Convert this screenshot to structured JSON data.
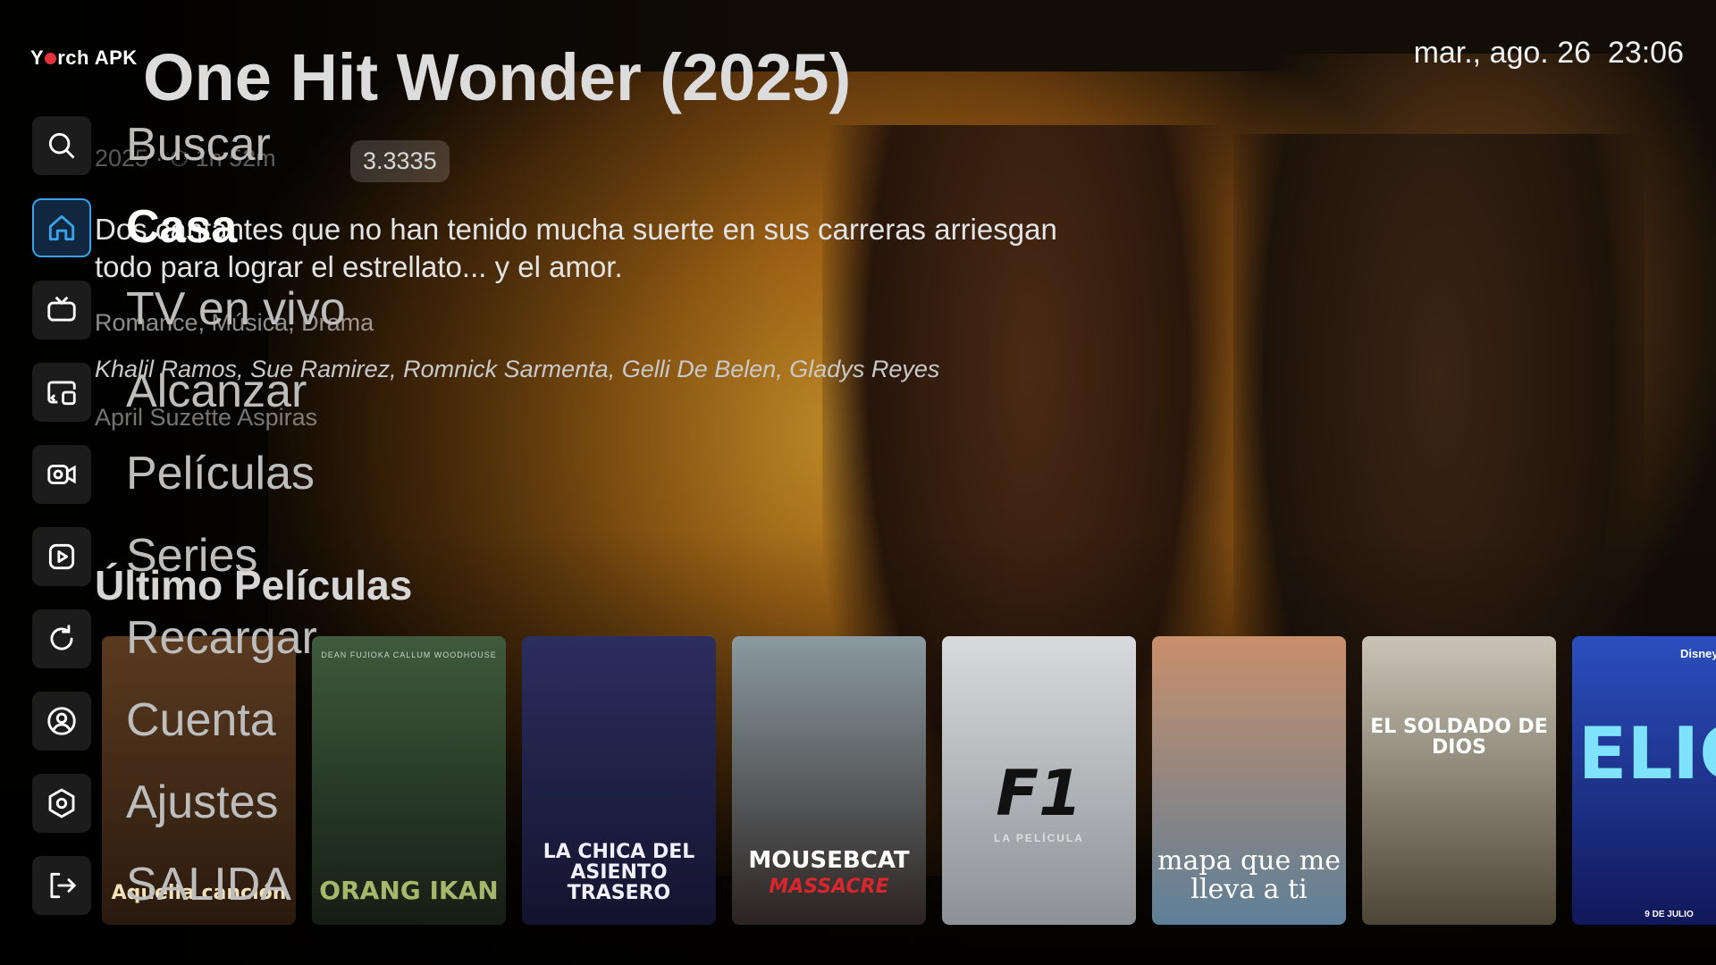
{
  "app": {
    "logo_left": "Y",
    "logo_right": "rch APK"
  },
  "datetime": "mar., ago. 26  23:06",
  "hero": {
    "title": "One Hit Wonder (2025)",
    "meta": "2025 · ⏱ 1h 52m",
    "rating": "3.3335",
    "description": "Dos cantantes que no han tenido mucha suerte en sus carreras arriesgan todo para lograr el estrellato... y el amor.",
    "genres": "Romance, Música, Drama",
    "cast": "Khalil Ramos, Sue Ramirez, Romnick Sarmenta, Gelli De Belen, Gladys Reyes",
    "director": "April Suzette Aspiras"
  },
  "row": {
    "title": "Último Películas",
    "posters": [
      {
        "title": "Aquella canción",
        "colors": [
          "#5a3a1f",
          "#2a1a0e"
        ],
        "text_color": "#f3e1b8"
      },
      {
        "title": "ORANG IKAN",
        "top_credit": "DEAN FUJIOKA   CALLUM WOODHOUSE",
        "colors": [
          "#3f5a3c",
          "#141e14"
        ],
        "text_color": "#a3b86a"
      },
      {
        "title": "LA CHICA DEL ASIENTO TRASERO",
        "colors": [
          "#2b2e5e",
          "#14132e"
        ],
        "text_color": "#f0f0ff"
      },
      {
        "title": "MOUSEBCAT",
        "subtitle_red": "MASSACRE",
        "colors": [
          "#8a9aa0",
          "#2b2321"
        ],
        "text_color": "#ffffff"
      },
      {
        "title": "F1",
        "subtitle": "LA PELÍCULA",
        "colors": [
          "#d9dadc",
          "#8d9196"
        ],
        "text_color": "#111111"
      },
      {
        "title": "mapa que me lleva a ti",
        "colors": [
          "#c98f6b",
          "#5e7f97"
        ],
        "text_color": "#ffffff"
      },
      {
        "title": "EL SOLDADO DE DIOS",
        "colors": [
          "#c9c4b7",
          "#4d4536"
        ],
        "text_color": "#ffffff"
      },
      {
        "title": "ELIO",
        "corner": "Disney PIXAR",
        "foot": "9 DE JULIO",
        "colors": [
          "#2b4fbf",
          "#11185a"
        ],
        "text_color": "#7fe3ff"
      }
    ]
  },
  "nav": [
    {
      "label": "Buscar",
      "icon": "search-icon"
    },
    {
      "label": "Casa",
      "icon": "home-icon",
      "active": true
    },
    {
      "label": "TV en vivo",
      "icon": "tv-icon"
    },
    {
      "label": "Alcanzar",
      "icon": "catchup-icon"
    },
    {
      "label": "Películas",
      "icon": "movie-camera-icon"
    },
    {
      "label": "Series",
      "icon": "play-icon"
    },
    {
      "label": "Recargar",
      "icon": "reload-icon"
    },
    {
      "label": "Cuenta",
      "icon": "account-icon"
    },
    {
      "label": "Ajustes",
      "icon": "gear-icon"
    },
    {
      "label": "SALIDA",
      "icon": "logout-icon"
    }
  ],
  "colors": {
    "accent": "#3aa2e8",
    "logo_dot": "#e5333c"
  }
}
